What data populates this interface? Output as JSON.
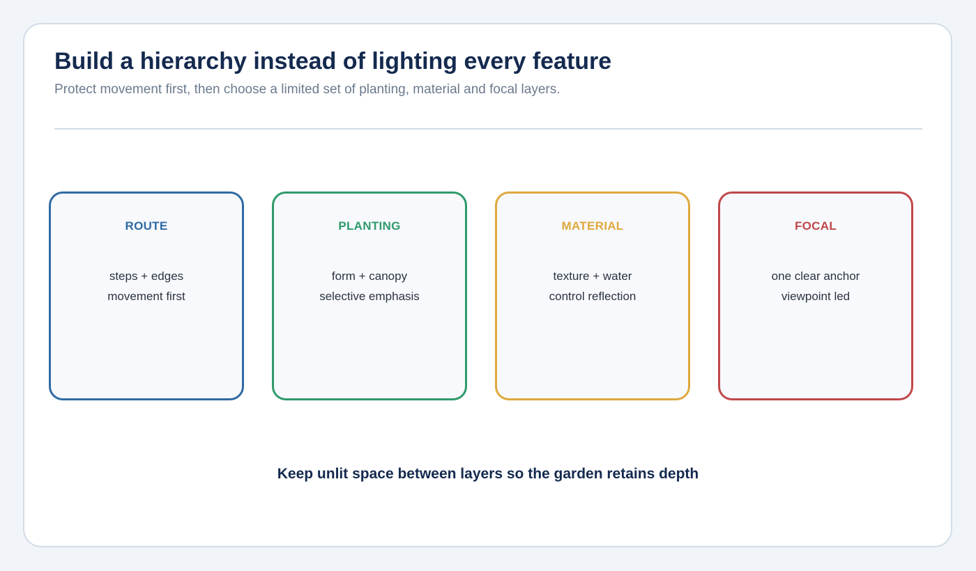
{
  "header": {
    "title": "Build a hierarchy instead of lighting every feature",
    "subtitle": "Protect movement first, then choose a limited set of planting, material and focal layers."
  },
  "layers": [
    {
      "title": "ROUTE",
      "line1": "steps + edges",
      "line2": "movement first",
      "color": "#2f6aa3"
    },
    {
      "title": "PLANTING",
      "line1": "form + canopy",
      "line2": "selective emphasis",
      "color": "#2f9a6c"
    },
    {
      "title": "MATERIAL",
      "line1": "texture + water",
      "line2": "control reflection",
      "color": "#e0a83e"
    },
    {
      "title": "FOCAL",
      "line1": "one clear anchor",
      "line2": "viewpoint led",
      "color": "#c0474a"
    }
  ],
  "footer": {
    "note": "Keep unlit space between layers so the garden retains depth"
  }
}
